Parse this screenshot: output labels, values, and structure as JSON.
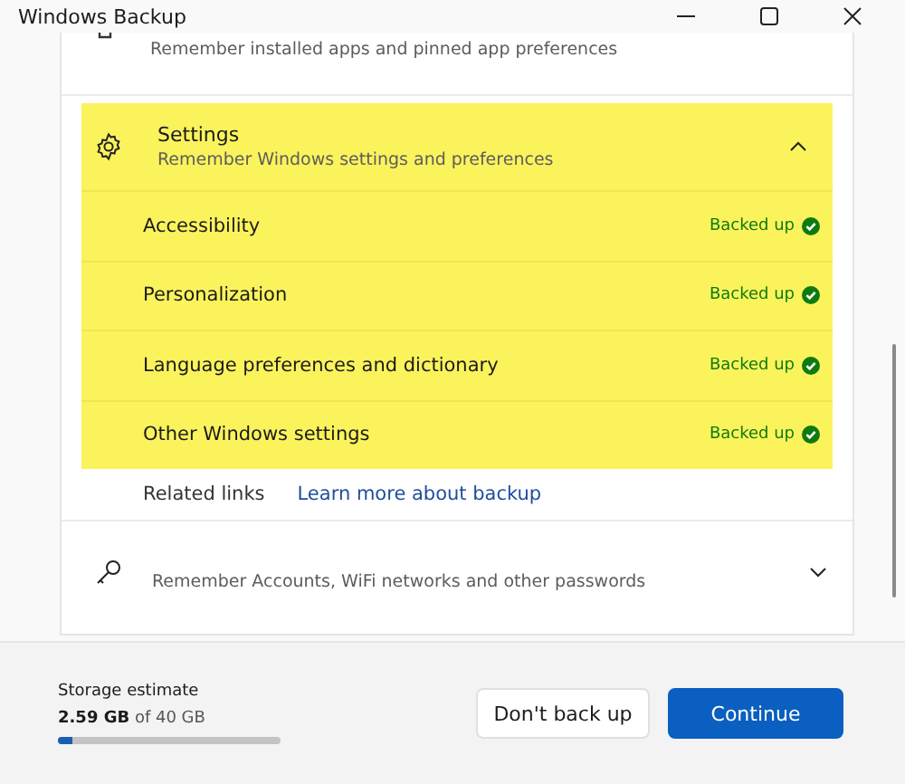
{
  "window": {
    "title": "Windows Backup"
  },
  "sections": [
    {
      "kind": "partial",
      "description": "Remember installed apps and pinned app preferences"
    },
    {
      "kind": "expanded",
      "title": "Settings",
      "description": "Remember Windows settings and preferences",
      "expanded": true,
      "highlighted": true,
      "items": [
        {
          "label": "Accessibility",
          "status": "Backed up"
        },
        {
          "label": "Personalization",
          "status": "Backed up"
        },
        {
          "label": "Language preferences and dictionary",
          "status": "Backed up"
        },
        {
          "label": "Other Windows settings",
          "status": "Backed up"
        }
      ],
      "related": {
        "label": "Related links",
        "link": "Learn more about backup"
      }
    },
    {
      "kind": "collapsed",
      "description": "Remember Accounts, WiFi networks and other passwords",
      "expanded": false
    }
  ],
  "footer": {
    "label": "Storage estimate",
    "usage": "**2.59 GB** of 40 GB",
    "level": 0.065,
    "buttons": [
      {
        "label": "Don't back up",
        "kind": "secondary"
      },
      {
        "label": "Continue",
        "kind": "primary"
      }
    ]
  }
}
